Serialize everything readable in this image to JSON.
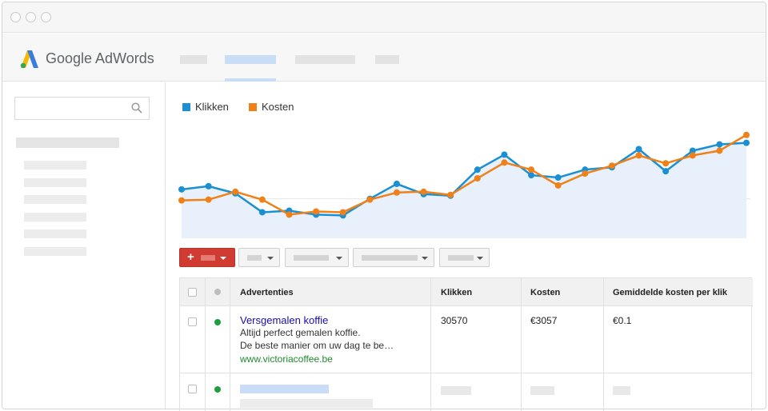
{
  "app": {
    "name": "Google AdWords"
  },
  "legend": [
    {
      "label": "Klikken",
      "color": "#1a8fd1"
    },
    {
      "label": "Kosten",
      "color": "#ef8118"
    }
  ],
  "chart_data": {
    "type": "line",
    "x": [
      1,
      2,
      3,
      4,
      5,
      6,
      7,
      8,
      9,
      10,
      11,
      12,
      13,
      14,
      15,
      16,
      17,
      18,
      19,
      20,
      21,
      22
    ],
    "series": [
      {
        "name": "Klikken",
        "color": "#1a8fd1",
        "values": [
          62,
          66,
          57,
          33,
          35,
          30,
          29,
          50,
          69,
          56,
          54,
          87,
          106,
          80,
          77,
          87,
          90,
          113,
          85,
          111,
          119,
          121
        ]
      },
      {
        "name": "Kosten",
        "color": "#ef8118",
        "values": [
          48,
          49,
          59,
          49,
          30,
          34,
          33,
          49,
          58,
          59,
          55,
          76,
          96,
          87,
          67,
          82,
          92,
          105,
          95,
          105,
          111,
          131
        ]
      }
    ],
    "ylim": [
      0,
      150
    ],
    "fill_color": "#e8f0fc",
    "grid": true
  },
  "table": {
    "headers": {
      "ads": "Advertenties",
      "clicks": "Klikken",
      "cost": "Kosten",
      "avg_cpc": "Gemiddelde kosten per klik"
    },
    "rows": [
      {
        "status_color": "#1e9e3e",
        "ad_title": "Versgemalen koffie",
        "ad_line1": "Altijd perfect gemalen koffie.",
        "ad_line2": "De beste manier om uw dag te be…",
        "ad_url": "www.victoriacoffee.be",
        "clicks": "30570",
        "cost": "€3057",
        "avg_cpc": "€0.1"
      }
    ],
    "placeholder_row": {
      "status_color": "#1e9e3e"
    }
  }
}
